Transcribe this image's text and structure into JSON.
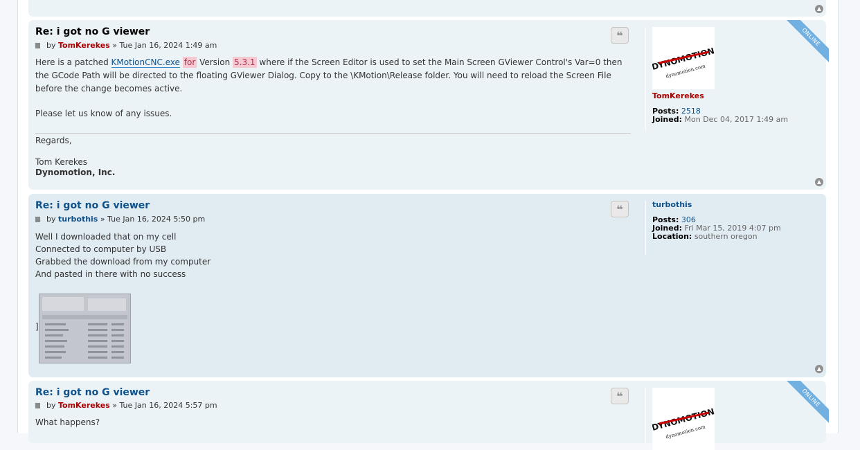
{
  "posts": [
    {
      "title": "Re: i got no G viewer",
      "by": "by",
      "author": "TomKerekes",
      "sep": "»",
      "date": "Tue Jan 16, 2024 1:49 am",
      "body_pre": "Here is a patched ",
      "link": "KMotionCNC.exe",
      "hl1": "for",
      "mid": " Version ",
      "hl2": "5.3.1",
      "body_post": " where if the Screen Editor is used to set the Main Screen GViewer Control's Var=0 then the GCode Path will be directed to the floating GViewer Dialog. Copy to the \\KMotion\\Release folder. You will need to reload the Screen File before the change becomes active.",
      "body2": "Please let us know of any issues.",
      "sig_regards": "Regards,",
      "sig_name": "Tom Kerekes",
      "sig_company": "Dynomotion, Inc.",
      "profile": {
        "name": "TomKerekes",
        "posts_label": "Posts:",
        "posts": "2518",
        "joined_label": "Joined:",
        "joined": "Mon Dec 04, 2017 1:49 am",
        "online": "ONLINE"
      }
    },
    {
      "title": "Re: i got no G viewer",
      "by": "by",
      "author": "turbothis",
      "sep": "»",
      "date": "Tue Jan 16, 2024 5:50 pm",
      "lines": [
        "Well I downloaded that on my cell",
        "Connected to computer by USB",
        "Grabbed the download from my computer",
        "And pasted in there with no success"
      ],
      "bracket": "]",
      "profile": {
        "name": "turbothis",
        "posts_label": "Posts:",
        "posts": "306",
        "joined_label": "Joined:",
        "joined": "Fri Mar 15, 2019 4:07 pm",
        "location_label": "Location:",
        "location": "southern oregon"
      }
    },
    {
      "title": "Re: i got no G viewer",
      "by": "by",
      "author": "TomKerekes",
      "sep": "»",
      "date": "Tue Jan 16, 2024 5:57 pm",
      "body": "What happens?",
      "profile": {
        "online": "ONLINE"
      }
    }
  ],
  "icons": {
    "quote": "quote-icon",
    "top": "back-to-top-icon",
    "post": "post-icon"
  },
  "avatar_text": {
    "brand": "DYNOMOTION",
    "url": "dynomotion.com"
  },
  "colors": {
    "post_bg": "#ecf3f7",
    "title_link": "#105289",
    "admin": "#aa0000",
    "online_badge": "#71b0e0"
  }
}
